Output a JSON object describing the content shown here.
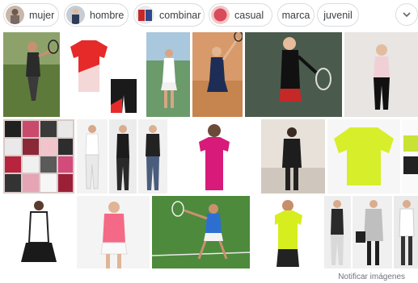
{
  "chips": [
    {
      "label": "mujer",
      "thumb_colors": [
        "#7a6a63",
        "#c9b7a8"
      ]
    },
    {
      "label": "hombre",
      "thumb_colors": [
        "#2d3d57",
        "#c8ccd3"
      ]
    },
    {
      "label": "combinar",
      "thumb_colors": [
        "#c62828",
        "#2e4a8c"
      ]
    },
    {
      "label": "casual",
      "thumb_colors": [
        "#d94b5b",
        "#f2c6c6"
      ]
    },
    {
      "label": "marca"
    },
    {
      "label": "juvenil"
    }
  ],
  "more_button_icon": "chevron-down-icon",
  "footer": {
    "report_images": "Notificar imágenes"
  }
}
